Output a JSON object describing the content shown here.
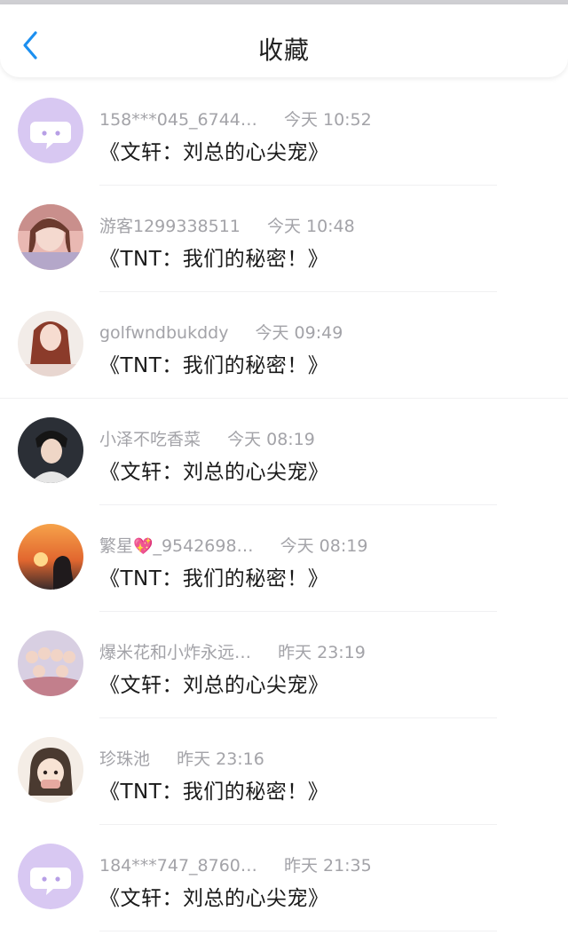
{
  "header": {
    "title": "收藏",
    "back_icon": "chevron-left-icon",
    "accent_color": "#1c8ff0"
  },
  "items": [
    {
      "name": "158***045_6744…",
      "time": "今天 10:52",
      "book": "《文轩：刘总的心尖宠》",
      "avatar": "default-chat-avatar"
    },
    {
      "name": "游客1299338511",
      "time": "今天 10:48",
      "book": "《TNT：我们的秘密！》",
      "avatar": "photo-girl-avatar"
    },
    {
      "name": "golfwndbukddy",
      "time": "今天 09:49",
      "book": "《TNT：我们的秘密！》",
      "avatar": "photo-girl-avatar"
    },
    {
      "name": "小泽不吃香菜",
      "time": "今天 08:19",
      "book": "《文轩：刘总的心尖宠》",
      "avatar": "photo-boy-avatar"
    },
    {
      "name_prefix": "繁星",
      "name_heart": "💖",
      "name_suffix": "_9542698…",
      "time": "今天 08:19",
      "book": "《TNT：我们的秘密！》",
      "avatar": "sunset-silhouette-avatar"
    },
    {
      "name": "爆米花和小炸永远…",
      "time": "昨天 23:19",
      "book": "《文轩：刘总的心尖宠》",
      "avatar": "group-photo-avatar"
    },
    {
      "name": "珍珠池",
      "time": "昨天 23:16",
      "book": "《TNT：我们的秘密！》",
      "avatar": "cartoon-girl-avatar"
    },
    {
      "name": "184***747_8760…",
      "time": "昨天 21:35",
      "book": "《文轩：刘总的心尖宠》",
      "avatar": "default-chat-avatar"
    }
  ]
}
